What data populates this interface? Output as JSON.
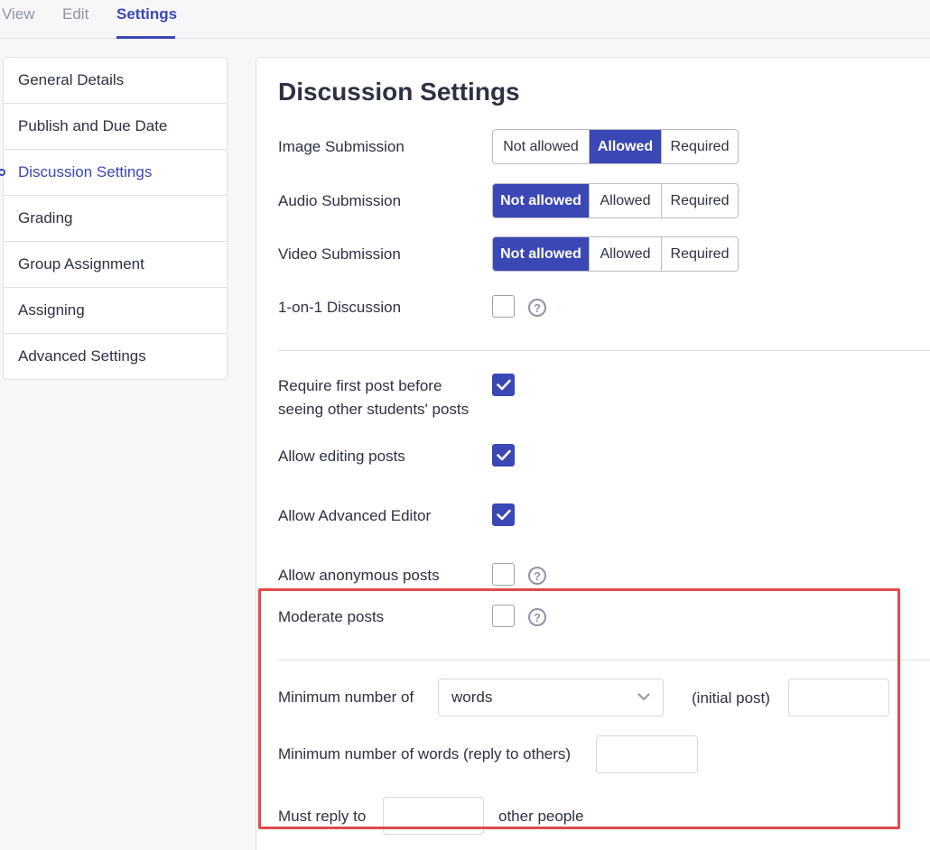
{
  "topnav": {
    "tabs": [
      "View",
      "Edit",
      "Settings"
    ],
    "active": "Settings"
  },
  "sidebar": {
    "items": [
      {
        "label": "General Details"
      },
      {
        "label": "Publish and Due Date"
      },
      {
        "label": "Discussion Settings",
        "active": true
      },
      {
        "label": "Grading"
      },
      {
        "label": "Group Assignment"
      },
      {
        "label": "Assigning"
      },
      {
        "label": "Advanced Settings"
      }
    ]
  },
  "main": {
    "title": "Discussion Settings",
    "submission_options": [
      "Not allowed",
      "Allowed",
      "Required"
    ],
    "image_submission": {
      "label": "Image Submission",
      "selected": "Allowed"
    },
    "audio_submission": {
      "label": "Audio Submission",
      "selected": "Not allowed"
    },
    "video_submission": {
      "label": "Video Submission",
      "selected": "Not allowed"
    },
    "one_on_one": {
      "label": "1-on-1 Discussion",
      "checked": false
    },
    "require_first_post": {
      "label_line1": "Require first post before",
      "label_line2": "seeing other students' posts",
      "checked": true
    },
    "allow_editing": {
      "label": "Allow editing posts",
      "checked": true
    },
    "allow_advanced_editor": {
      "label": "Allow Advanced Editor",
      "checked": true
    },
    "allow_anonymous": {
      "label": "Allow anonymous posts",
      "checked": false
    },
    "moderate_posts": {
      "label": "Moderate posts",
      "checked": false
    },
    "min_initial": {
      "label": "Minimum number of",
      "select_value": "words",
      "suffix": "(initial post)",
      "value": ""
    },
    "min_reply": {
      "label": "Minimum number of words (reply to others)",
      "value": ""
    },
    "must_reply": {
      "label": "Must reply to",
      "suffix": "other people",
      "value": ""
    }
  },
  "colors": {
    "accent": "#3b47b5",
    "highlight": "#e04a4a"
  }
}
